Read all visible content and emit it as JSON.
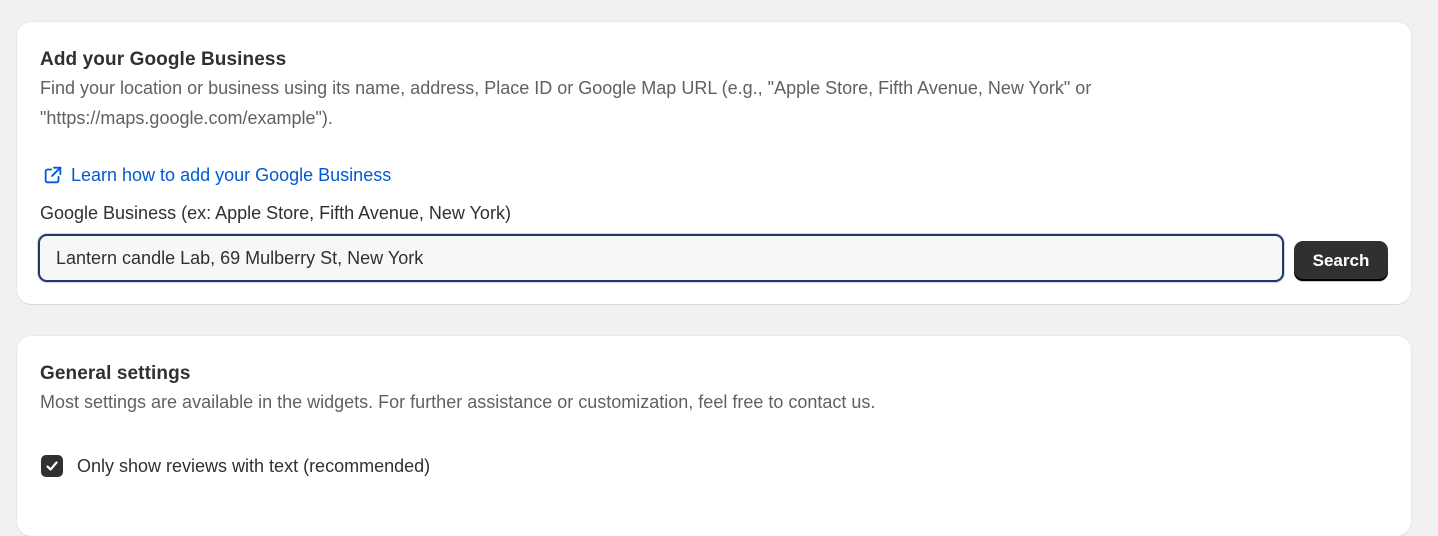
{
  "business_card": {
    "title": "Add your Google Business",
    "description": "Find your location or business using its name, address, Place ID or Google Map URL (e.g., \"Apple Store, Fifth Avenue, New York\" or \"https://maps.google.com/example\").",
    "learn_link": {
      "label": "Learn how to add your Google Business",
      "icon": "external-link-icon",
      "color": "#005bd3"
    },
    "field_label": "Google Business (ex: Apple Store, Fifth Avenue, New York)",
    "input_value": "Lantern candle Lab, 69 Mulberry St, New York",
    "search_button": "Search"
  },
  "general_card": {
    "title": "General settings",
    "description": "Most settings are available in the widgets. For further assistance or customization, feel free to contact us.",
    "checkbox": {
      "label": "Only show reviews with text (recommended)",
      "checked": true,
      "icon": "checkmark-icon"
    }
  },
  "colors": {
    "page_background": "#f1f1f1",
    "card_background": "#ffffff",
    "primary_button": "#303030",
    "link": "#005bd3",
    "input_focus_border": "#1f3a63"
  }
}
